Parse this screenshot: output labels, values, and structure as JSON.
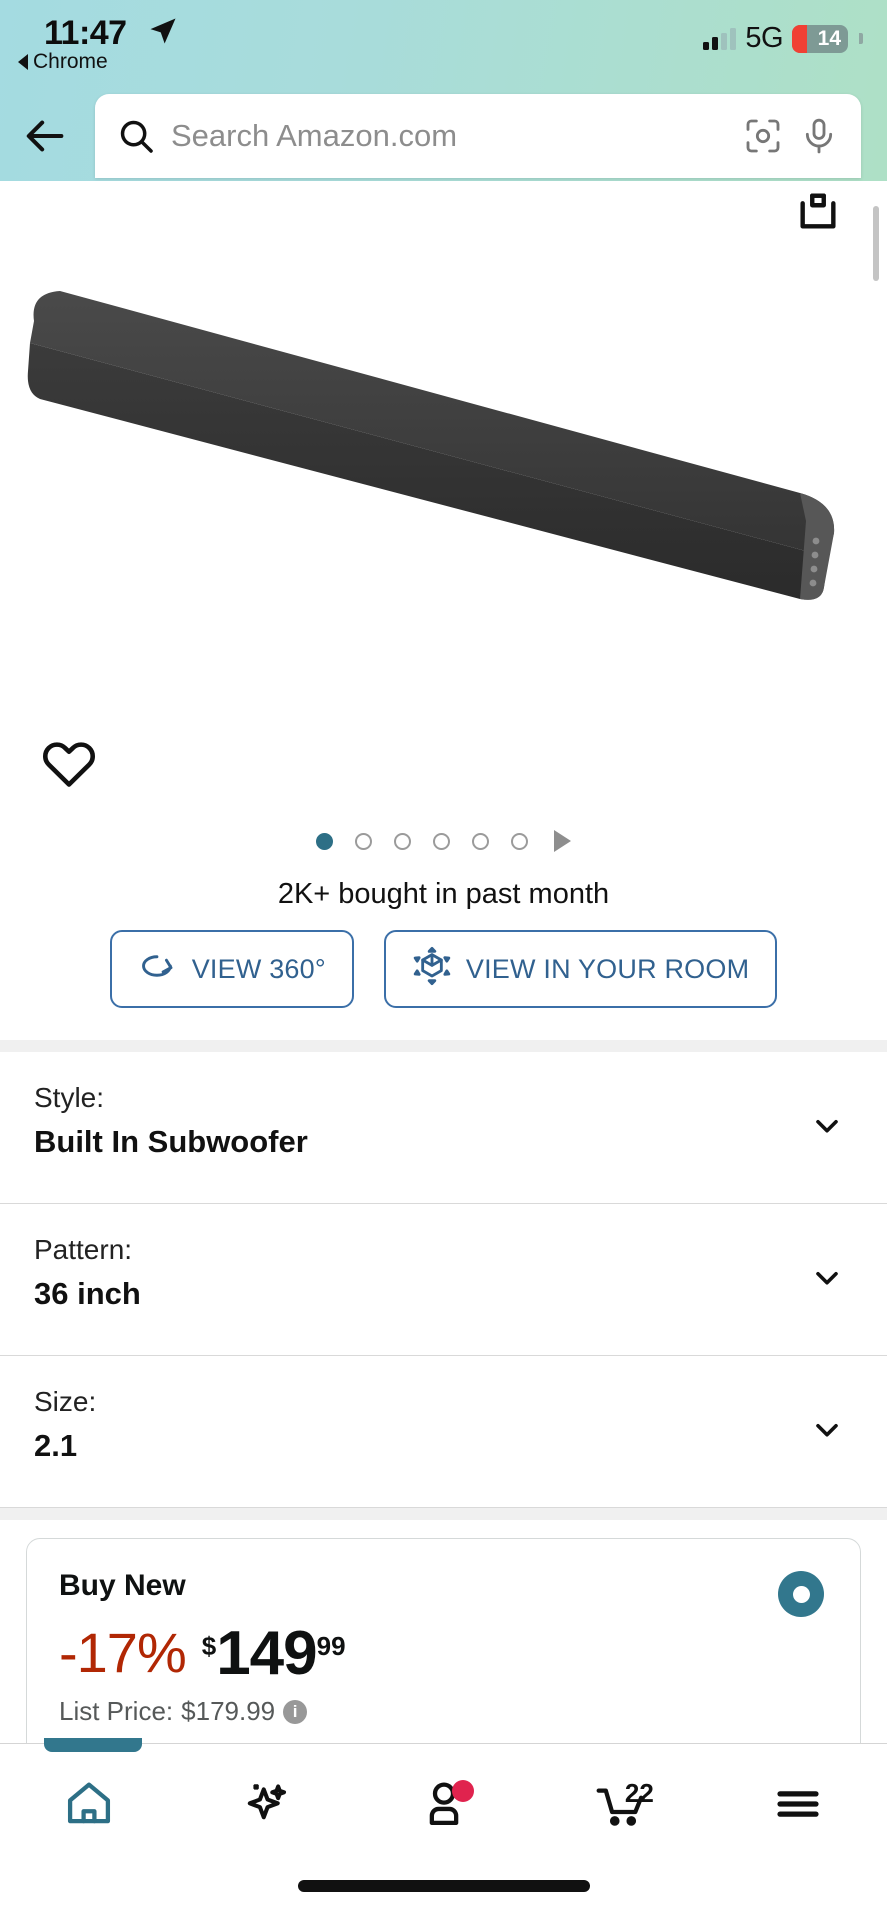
{
  "status_bar": {
    "time": "11:47",
    "location_icon": "location-arrow-icon",
    "return_app_label": "Chrome",
    "network": "5G",
    "battery_level": "14",
    "signal_icon": "cellular-signal-icon"
  },
  "header": {
    "back_icon": "back-arrow-icon",
    "search": {
      "placeholder": "Search Amazon.com",
      "value": "",
      "search_icon": "search-icon",
      "camera_icon": "camera-lens-icon",
      "mic_icon": "microphone-icon"
    },
    "gradient_start": "#a4dbe1",
    "gradient_end": "#aee0c6"
  },
  "gallery": {
    "share_icon": "share-box-icon",
    "wishlist_icon": "heart-outline-icon",
    "dot_count": 6,
    "active_dot_index": 0,
    "active_dot_color": "#2d6f86",
    "play_icon": "play-triangle-icon",
    "social_proof": "2K+ bought in past month",
    "buttons": [
      {
        "label": "VIEW 360°",
        "icon": "rotate-360-icon"
      },
      {
        "label": "VIEW IN YOUR ROOM",
        "icon": "ar-cube-icon"
      }
    ],
    "button_color": "#31618f"
  },
  "variations": [
    {
      "label": "Style:",
      "value": "Built In Subwoofer",
      "chevron": "chevron-down-icon"
    },
    {
      "label": "Pattern:",
      "value": "36 inch",
      "chevron": "chevron-down-icon"
    },
    {
      "label": "Size:",
      "value": "2.1",
      "chevron": "chevron-down-icon"
    }
  ],
  "buy_box": {
    "title": "Buy New",
    "selected": true,
    "radio_color": "#32778d",
    "discount": "-17%",
    "discount_color": "#b12704",
    "currency": "$",
    "price_whole": "149",
    "price_fraction": "99",
    "list_price_label": "List Price:",
    "list_price_value": "$179.99",
    "info_icon": "info-icon",
    "info_glyph": "i"
  },
  "bottom_nav": {
    "items": [
      {
        "name": "home",
        "icon": "home-icon",
        "active": true
      },
      {
        "name": "rufus",
        "icon": "sparkle-icon",
        "active": false
      },
      {
        "name": "account",
        "icon": "person-icon",
        "active": false,
        "badge_dot": true
      },
      {
        "name": "cart",
        "icon": "cart-icon",
        "active": false,
        "badge_count": "22"
      },
      {
        "name": "menu",
        "icon": "hamburger-icon",
        "active": false
      }
    ],
    "active_color": "#2d6f86",
    "badge_dot_color": "#e0234e"
  }
}
